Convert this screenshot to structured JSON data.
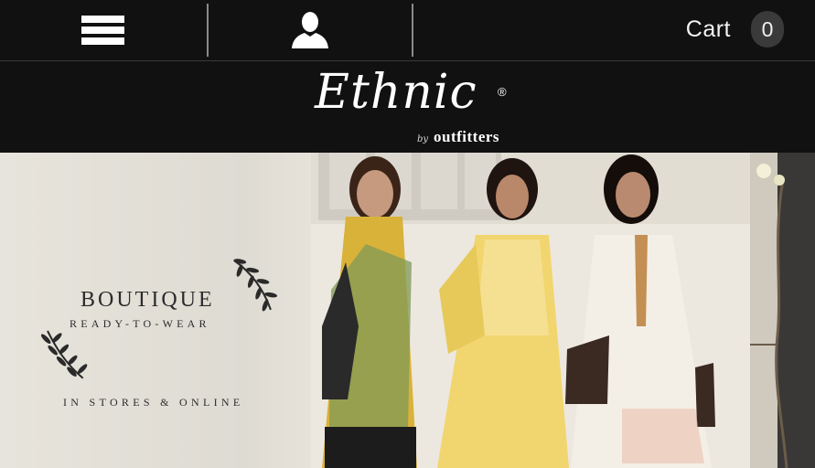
{
  "header": {
    "menu_icon": "hamburger-menu-icon",
    "account_icon": "user-silhouette-icon",
    "cart_label": "Cart",
    "cart_count": "0"
  },
  "brand": {
    "name": "Ethnic",
    "registered": "®",
    "by": "by",
    "sub": "outfitters"
  },
  "hero": {
    "line1": "BOUTIQUE",
    "line2": "READY-TO-WEAR",
    "line3": "IN STORES & ONLINE"
  },
  "colors": {
    "header_bg": "#111111",
    "cart_badge_bg": "#3a3a3a",
    "hero_bg": "#e7e4dc",
    "garment_yellow": "#f1d56e",
    "garment_ivory": "#f4efe6"
  }
}
